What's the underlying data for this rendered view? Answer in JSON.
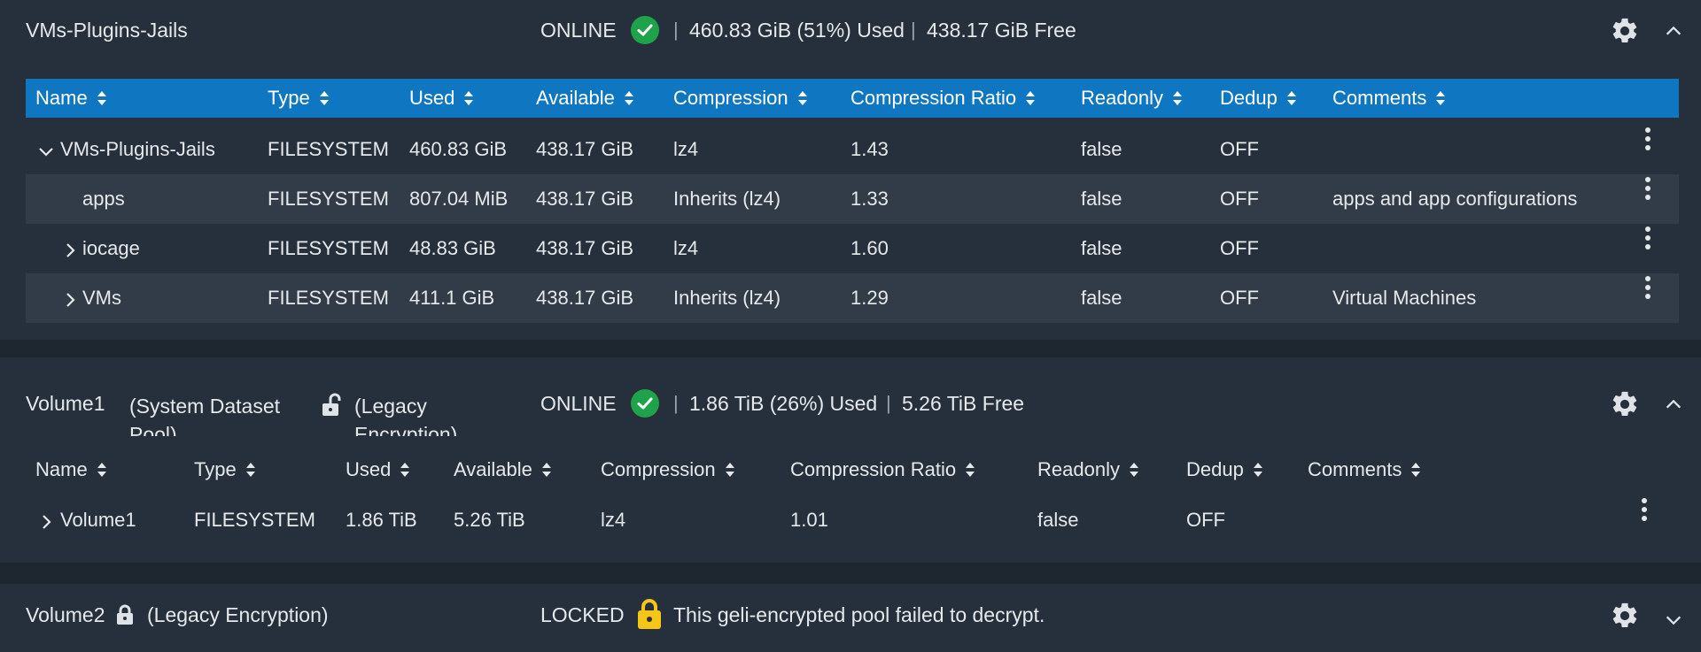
{
  "pool1": {
    "name": "VMs-Plugins-Jails",
    "status": "ONLINE",
    "used": "460.83 GiB (51%) Used",
    "free": "438.17 GiB Free",
    "columns": [
      "Name",
      "Type",
      "Used",
      "Available",
      "Compression",
      "Compression Ratio",
      "Readonly",
      "Dedup",
      "Comments"
    ],
    "rows": [
      {
        "name": "VMs-Plugins-Jails",
        "type": "FILESYSTEM",
        "used": "460.83 GiB",
        "available": "438.17 GiB",
        "compression": "lz4",
        "ratio": "1.43",
        "readonly": "false",
        "dedup": "OFF",
        "comments": ""
      },
      {
        "name": "apps",
        "type": "FILESYSTEM",
        "used": "807.04 MiB",
        "available": "438.17 GiB",
        "compression": "Inherits (lz4)",
        "ratio": "1.33",
        "readonly": "false",
        "dedup": "OFF",
        "comments": "apps and app configurations"
      },
      {
        "name": "iocage",
        "type": "FILESYSTEM",
        "used": "48.83 GiB",
        "available": "438.17 GiB",
        "compression": "lz4",
        "ratio": "1.60",
        "readonly": "false",
        "dedup": "OFF",
        "comments": ""
      },
      {
        "name": "VMs",
        "type": "FILESYSTEM",
        "used": "411.1 GiB",
        "available": "438.17 GiB",
        "compression": "Inherits (lz4)",
        "ratio": "1.29",
        "readonly": "false",
        "dedup": "OFF",
        "comments": "Virtual Machines"
      }
    ]
  },
  "pool2": {
    "name": "Volume1",
    "system_dataset_line1": "(System Dataset",
    "system_dataset_line2": "Pool)",
    "encryption_line1": "(Legacy",
    "encryption_line2": "Encryption)",
    "status": "ONLINE",
    "used": "1.86 TiB (26%) Used",
    "free": "5.26 TiB Free",
    "columns": [
      "Name",
      "Type",
      "Used",
      "Available",
      "Compression",
      "Compression Ratio",
      "Readonly",
      "Dedup",
      "Comments"
    ],
    "rows": [
      {
        "name": "Volume1",
        "type": "FILESYSTEM",
        "used": "1.86 TiB",
        "available": "5.26 TiB",
        "compression": "lz4",
        "ratio": "1.01",
        "readonly": "false",
        "dedup": "OFF",
        "comments": ""
      }
    ]
  },
  "pool3": {
    "name": "Volume2",
    "encryption": "(Legacy Encryption)",
    "status": "LOCKED",
    "message": "This geli-encrypted pool failed to decrypt."
  },
  "colors": {
    "background": "#1e2630",
    "panel": "#26303c",
    "header_accent": "#0f77c2",
    "online": "#1ea34b",
    "locked": "#f5c518"
  },
  "icons": [
    "check-circle-icon",
    "gear-icon",
    "chevron-up-icon",
    "chevron-down-icon",
    "chevron-right-icon",
    "sort-icon",
    "kebab-icon",
    "unlock-icon",
    "lock-icon"
  ]
}
